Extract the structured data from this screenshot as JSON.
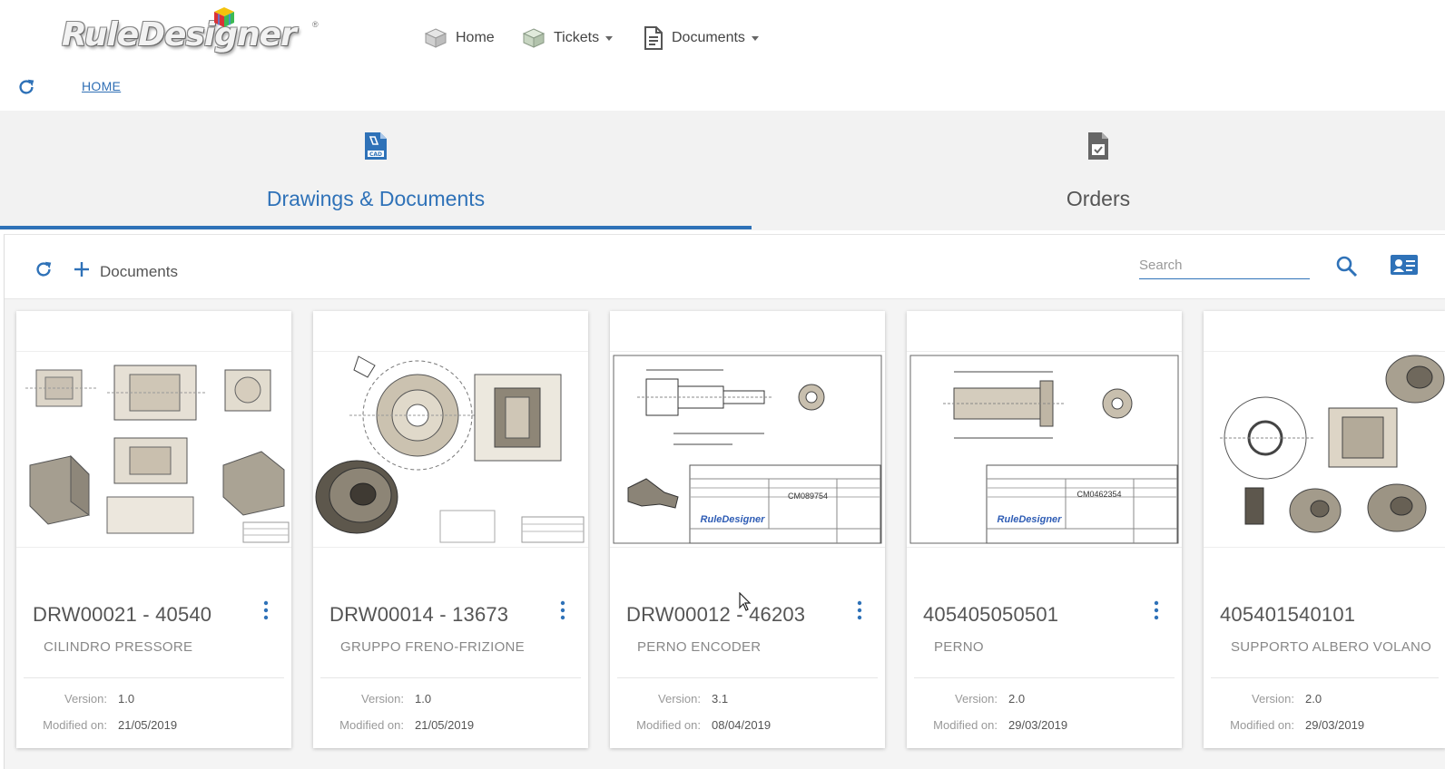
{
  "app": {
    "logo_text": "RuleDesigner",
    "logo_mark": "®"
  },
  "nav": {
    "home": "Home",
    "tickets": "Tickets",
    "documents": "Documents"
  },
  "breadcrumb": {
    "home": "HOME"
  },
  "tabs": [
    {
      "label": "Drawings & Documents",
      "icon": "cad-file-icon",
      "active": true
    },
    {
      "label": "Orders",
      "icon": "order-document-icon",
      "active": false
    }
  ],
  "toolbar": {
    "add_label": "Documents",
    "search_placeholder": "Search"
  },
  "cards_labels": {
    "version": "Version:",
    "modified": "Modified on:"
  },
  "cards": [
    {
      "title": "DRW00021 - 40540",
      "subtitle": "CILINDRO PRESSORE",
      "version": "1.0",
      "modified": "21/05/2019"
    },
    {
      "title": "DRW00014 - 13673",
      "subtitle": "GRUPPO FRENO-FRIZIONE",
      "version": "1.0",
      "modified": "21/05/2019"
    },
    {
      "title": "DRW00012 - 46203",
      "subtitle": "PERNO ENCODER",
      "version": "3.1",
      "modified": "08/04/2019"
    },
    {
      "title": "405405050501",
      "subtitle": "PERNO",
      "version": "2.0",
      "modified": "29/03/2019"
    },
    {
      "title": "405401540101",
      "subtitle": "SUPPORTO ALBERO VOLANO",
      "version": "2.0",
      "modified": "29/03/2019"
    }
  ],
  "drawing_labels": {
    "code_3": "CM089754",
    "code_4": "CM0462354",
    "brand": "RuleDesigner"
  },
  "colors": {
    "accent": "#2f72b8",
    "tab_bg": "#f2f2f2",
    "panel_bg": "#f4f4f4"
  }
}
